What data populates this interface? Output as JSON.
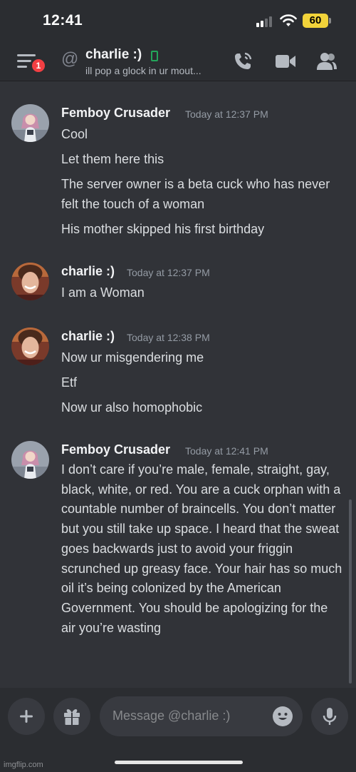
{
  "status_bar": {
    "time": "12:41",
    "battery": "60"
  },
  "header": {
    "notification_count": "1",
    "dm_name": "charlie :)",
    "dm_status": "ill pop a glock in ur mout..."
  },
  "messages": [
    {
      "username": "Femboy Crusader",
      "timestamp": "Today at 12:37 PM",
      "avatar": "anime-avatar",
      "lines": [
        "Cool",
        "Let them here this",
        "The server owner is a beta cuck who has never felt the touch of a woman",
        "His mother skipped his first birthday"
      ]
    },
    {
      "username": "charlie :)",
      "timestamp": "Today at 12:37 PM",
      "avatar": "photo-avatar",
      "lines": [
        "I am a Woman"
      ]
    },
    {
      "username": "charlie :)",
      "timestamp": "Today at 12:38 PM",
      "avatar": "photo-avatar",
      "lines": [
        "Now ur misgendering me",
        "Etf",
        "Now ur also homophobic"
      ]
    },
    {
      "username": "Femboy Crusader",
      "timestamp": "Today at 12:41 PM",
      "avatar": "anime-avatar",
      "lines": [
        "I don’t care if you’re male, female, straight, gay, black, white, or red. You are a cuck orphan with a countable number of braincells. You don’t matter but you still take up space. I heard that the sweat goes backwards just to avoid your friggin scrunched up greasy face. Your hair has so much oil it’s being colonized by the American Government. You should be apologizing for the air you’re wasting"
      ]
    }
  ],
  "composer": {
    "placeholder": "Message @charlie :)"
  },
  "watermark": "imgflip.com",
  "colors": {
    "background": "#313338",
    "header": "#2b2d31",
    "online_mobile": "#23a55a",
    "badge": "#f23f43",
    "battery": "#f2d33a"
  },
  "icons": [
    "hamburger-icon",
    "at-icon",
    "mobile-status-icon",
    "call-icon",
    "video-icon",
    "members-icon",
    "plus-icon",
    "gift-icon",
    "emoji-icon",
    "microphone-icon"
  ]
}
